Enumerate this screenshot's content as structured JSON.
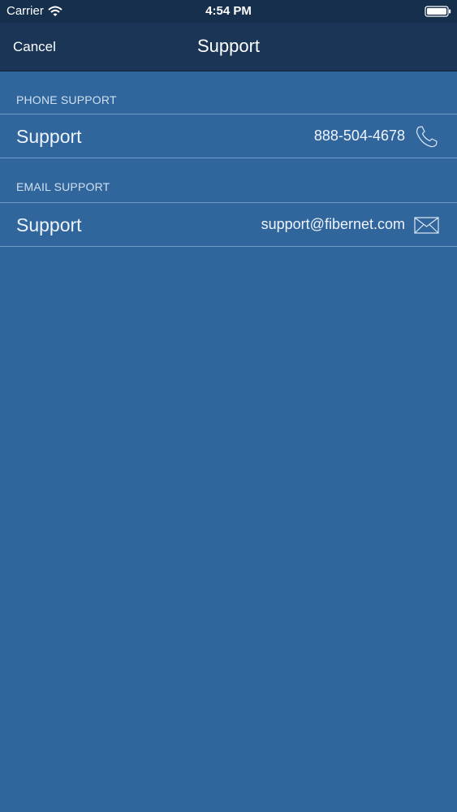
{
  "status_bar": {
    "carrier": "Carrier",
    "time": "4:54 PM"
  },
  "nav": {
    "cancel_label": "Cancel",
    "title": "Support"
  },
  "sections": [
    {
      "header": "PHONE SUPPORT",
      "row": {
        "label": "Support",
        "value": "888-504-4678",
        "icon": "phone-icon"
      }
    },
    {
      "header": "EMAIL SUPPORT",
      "row": {
        "label": "Support",
        "value": "support@fibernet.com",
        "icon": "envelope-icon"
      }
    }
  ],
  "colors": {
    "background": "#31669d",
    "nav_bar": "#1a3556",
    "status_bar": "#162f4d",
    "separator": "#6f9cc9",
    "header_text": "#cfe0f2"
  }
}
